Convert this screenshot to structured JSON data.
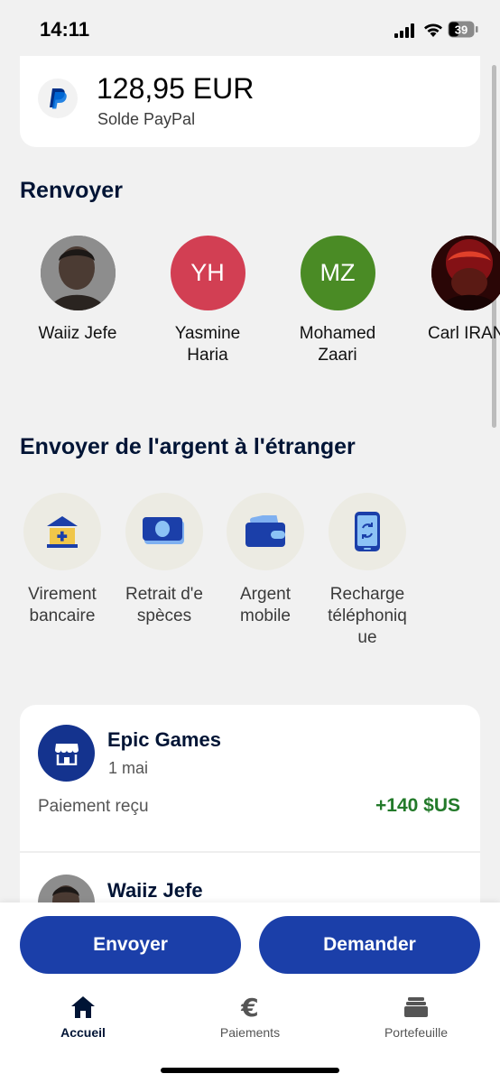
{
  "status_bar": {
    "time": "14:11",
    "battery": "39"
  },
  "balance": {
    "amount": "128,95 EUR",
    "label": "Solde PayPal"
  },
  "resend": {
    "title": "Renvoyer",
    "contacts": [
      {
        "name": "Waiiz Jefe",
        "initials": "",
        "color": "#6b6b6b"
      },
      {
        "name": "Yasmine Haria",
        "initials": "YH",
        "color": "#d23f53"
      },
      {
        "name": "Mohamed Zaari",
        "initials": "MZ",
        "color": "#4a8b25"
      },
      {
        "name": "Carl IRAN",
        "initials": "",
        "color": "#3a0d0d"
      }
    ]
  },
  "international": {
    "title": "Envoyer de l'argent à l'étranger",
    "services": [
      {
        "label": "Virement bancaire",
        "icon": "bank-icon"
      },
      {
        "label": "Retrait d'espèces",
        "icon": "cash-icon"
      },
      {
        "label": "Argent mobile",
        "icon": "wallet-icon"
      },
      {
        "label": "Recharge téléphonique",
        "icon": "phone-refresh-icon"
      }
    ]
  },
  "activity": [
    {
      "title": "Epic Games",
      "date": "1 mai",
      "description": "Paiement reçu",
      "amount": "+140 $US",
      "icon": "store-icon"
    },
    {
      "title": "Waiiz Jefe"
    }
  ],
  "actions": {
    "send": "Envoyer",
    "request": "Demander"
  },
  "tabs": [
    {
      "label": "Accueil",
      "icon": "home-icon",
      "active": true
    },
    {
      "label": "Paiements",
      "icon": "euro-icon",
      "active": false
    },
    {
      "label": "Portefeuille",
      "icon": "wallet-stack-icon",
      "active": false
    }
  ]
}
